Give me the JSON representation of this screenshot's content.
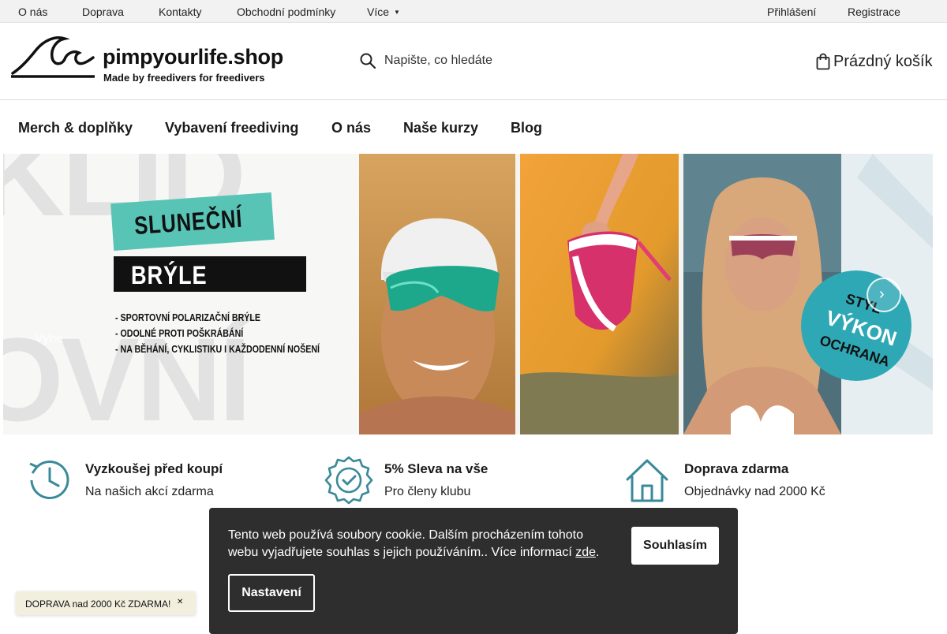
{
  "topbar": {
    "links": [
      "O nás",
      "Doprava",
      "Kontakty",
      "Obchodní podmínky",
      "Více"
    ],
    "more_icon": "chevron-down-icon",
    "login": "Přihlášení",
    "register": "Registrace"
  },
  "header": {
    "logo_title": "pimpyourlife.shop",
    "logo_subtitle": "Made by freedivers for freedivers",
    "search_placeholder": "Napište, co hledáte",
    "cart_label": "Prázdný košík"
  },
  "nav": {
    "items": [
      "Merch & doplňky",
      "Vybavení freediving",
      "O nás",
      "Naše kurzy",
      "Blog"
    ]
  },
  "hero": {
    "tag_top": "SLUNEČNÍ",
    "tag_main": "BRÝLE",
    "bullets": [
      "- SPORTOVNÍ POLARIZAČNÍ BRÝLE",
      "- ODOLNÉ PROTI POŠKRÁBÁNÍ",
      "- NA BĚHÁNÍ, CYKLISTIKU I KAŽDODENNÍ NOŠENÍ"
    ],
    "badge_lines": [
      "STYL",
      "VÝKON",
      "OCHRANA"
    ],
    "caption": "Vybe",
    "next_icon": "chevron-right-icon",
    "accent_color": "#58c4b6",
    "badge_color": "#2fa8b5"
  },
  "benefits": [
    {
      "icon": "history-clock-icon",
      "title": "Vyzkoušej před koupí",
      "subtitle": "Na našich akcí zdarma"
    },
    {
      "icon": "check-badge-icon",
      "title": "5% Sleva na vše",
      "subtitle": "Pro členy klubu"
    },
    {
      "icon": "house-icon",
      "title": "Doprava zdarma",
      "subtitle": "Objednávky nad 2000 Kč"
    }
  ],
  "cookie": {
    "text": "Tento web používá soubory cookie. Dalším procházením tohoto webu vyjadřujete souhlas s jejich používáním.. Více informací ",
    "link": "zde",
    "text_end": ".",
    "accept": "Souhlasím",
    "settings": "Nastavení"
  },
  "shipping_bar": {
    "text": "DOPRAVA nad 2000 Kč ZDARMA!",
    "close_icon": "close-icon"
  }
}
